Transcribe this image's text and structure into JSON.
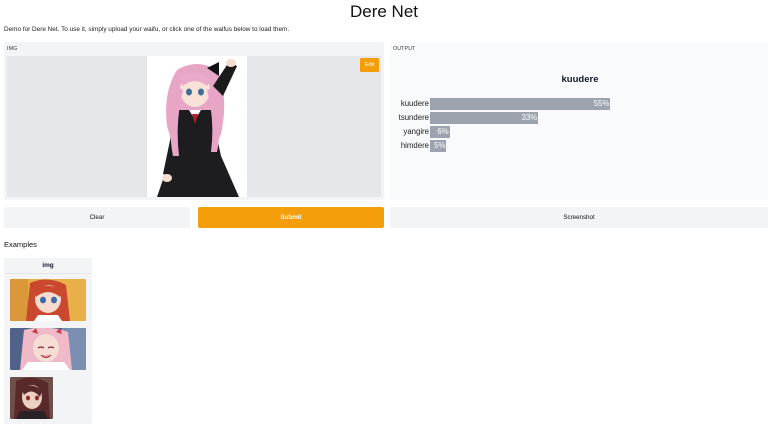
{
  "app": {
    "title": "Dere Net",
    "description": "Demo for Dere Net. To use it, simply upload your waifu, or click one of the waifus below to load them."
  },
  "input": {
    "label": "IMG",
    "edit_label": "Edit"
  },
  "output": {
    "label": "OUTPUT",
    "top_label": "kuudere",
    "confidences": [
      {
        "label": "kuudere",
        "percent": 55,
        "text": "55%"
      },
      {
        "label": "tsundere",
        "percent": 33,
        "text": "33%"
      },
      {
        "label": "yangire",
        "percent": 6,
        "text": "6%"
      },
      {
        "label": "himdere",
        "percent": 5,
        "text": "5%"
      }
    ]
  },
  "buttons": {
    "clear": "Clear",
    "submit": "Submit",
    "screenshot": "Screenshot"
  },
  "examples": {
    "title": "Examples",
    "column": "img",
    "items": [
      "example-1",
      "example-2",
      "example-3"
    ]
  },
  "colors": {
    "accent": "#f59e0b",
    "bar": "#9ca3af",
    "panel": "#f3f4f6"
  }
}
